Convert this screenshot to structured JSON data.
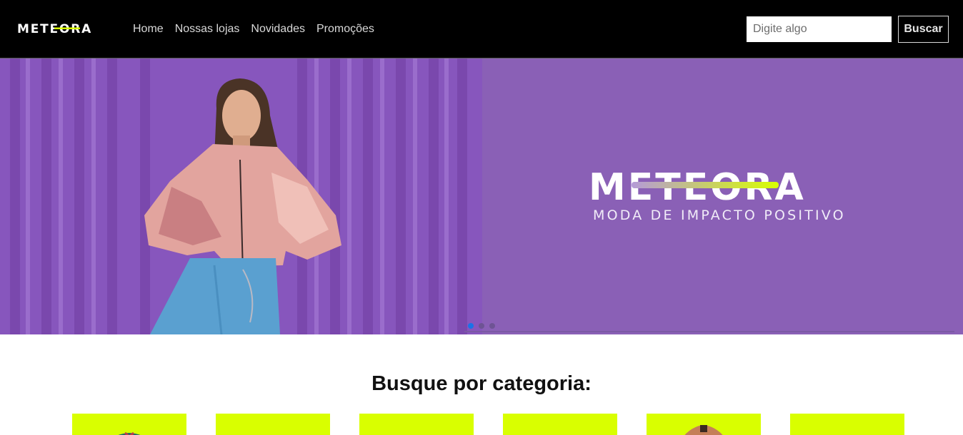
{
  "brand": {
    "logo_text": "METEORA",
    "hero_logo_text": "METEORA",
    "tagline": "MODA DE IMPACTO POSITIVO",
    "accent_color": "#d9ff00",
    "hero_bg_color": "#8a60b6"
  },
  "nav": {
    "items": [
      {
        "label": "Home"
      },
      {
        "label": "Nossas lojas"
      },
      {
        "label": "Novidades"
      },
      {
        "label": "Promoções"
      }
    ]
  },
  "search": {
    "placeholder": "Digite algo",
    "value": "",
    "button_label": "Buscar"
  },
  "carousel": {
    "slide_count": 3,
    "active_index": 0
  },
  "categories": {
    "title": "Busque por categoria:",
    "cards": [
      {
        "icon": "shirt-icon"
      },
      {
        "icon": "blank"
      },
      {
        "icon": "blank"
      },
      {
        "icon": "hanger-icon"
      },
      {
        "icon": "jacket-icon"
      },
      {
        "icon": "blank"
      }
    ]
  }
}
